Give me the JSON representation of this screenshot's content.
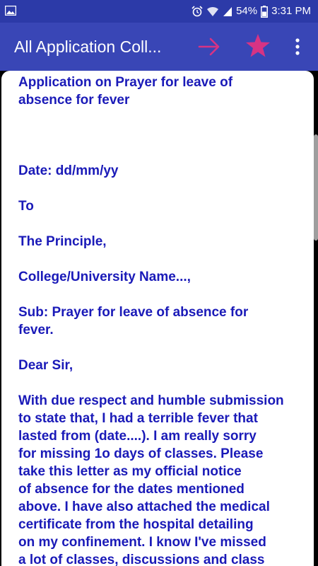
{
  "status_bar": {
    "battery_percent": "54%",
    "time": "3:31 PM",
    "icons": [
      "image-icon",
      "alarm-icon",
      "wifi-icon",
      "signal-icon",
      "battery-icon"
    ]
  },
  "app_bar": {
    "title": "All Application Coll...",
    "icons": [
      "arrow-right-icon",
      "star-icon",
      "more-vert-icon"
    ],
    "accent_color": "#d63384",
    "background": "#3946b6"
  },
  "letter": {
    "text_color": "#1a1ab8",
    "title_lines": [
      "Application on Prayer for leave of",
      "absence for fever"
    ],
    "date": "Date: dd/mm/yy",
    "to": "To",
    "recipient": "The Principle,",
    "institution": "College/University Name...,",
    "subject_lines": [
      "Sub: Prayer for leave of absence for",
      "fever."
    ],
    "salutation": "Dear Sir,",
    "body_lines": [
      "With due respect and humble submission",
      "to state that, I had a terrible fever that",
      "lasted from (date....). I am really sorry",
      "for missing 1o days of classes. Please",
      "take this letter as my official notice",
      "of absence for the dates mentioned",
      "above. I have also attached the medical",
      "certificate from the hospital detailing",
      "on my confinement. I know I've missed",
      "a lot of classes, discussions and class"
    ]
  }
}
